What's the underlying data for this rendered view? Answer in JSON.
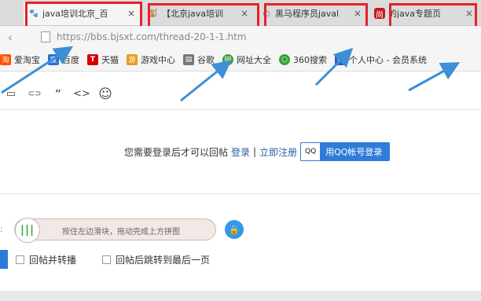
{
  "browser": {
    "tabs": [
      {
        "title": "java培训北京_百",
        "favicon": "paw-icon",
        "favicon_char": "🐾",
        "favicon_color": "#2b6fd6"
      },
      {
        "title": "【北京java培训",
        "favicon": "monkey-icon",
        "favicon_char": "🐒",
        "favicon_color": "#e08a1e"
      },
      {
        "title": "黑马程序员javal",
        "favicon": "globe-icon",
        "favicon_char": "◐",
        "favicon_color": "#666666"
      },
      {
        "title": "的java专题页",
        "favicon": "shang-icon",
        "favicon_char": "尚",
        "favicon_color": "#c41a1a"
      }
    ],
    "close_char": "×",
    "back_char": "‹",
    "url": "https://bbs.bjsxt.com/thread-20-1-1.htm"
  },
  "bookmarks": [
    {
      "label": "爱淘宝",
      "icon": "taobao-icon",
      "icon_char": "淘",
      "color": "#ff5000"
    },
    {
      "label": "百度",
      "icon": "baidu-paw-icon",
      "icon_char": "度",
      "color": "#2b6fd6"
    },
    {
      "label": "天猫",
      "icon": "tmall-icon",
      "icon_char": "T",
      "color": "#d40000"
    },
    {
      "label": "游戏中心",
      "icon": "game-icon",
      "icon_char": "游",
      "color": "#e89b1c"
    },
    {
      "label": "谷歌",
      "icon": "page-icon",
      "icon_char": "▤",
      "color": "#777777"
    },
    {
      "label": "网址大全",
      "icon": "sites-icon",
      "icon_char": "网",
      "color": "#3c9a3c"
    },
    {
      "label": "360搜索",
      "icon": "search360-icon",
      "icon_char": "○",
      "color": "#37a237"
    },
    {
      "label": "个人中心 - 会员系统",
      "icon": "member-icon",
      "icon_char": "▣",
      "color": "#2b5fb8"
    }
  ],
  "editor_toolbar": [
    {
      "name": "image-icon",
      "char": "▭"
    },
    {
      "name": "link-icon",
      "char": "⊂⊃"
    },
    {
      "name": "quote-icon",
      "char": "“"
    },
    {
      "name": "code-icon",
      "char": "<>"
    },
    {
      "name": "emoji-icon",
      "char": "☺"
    }
  ],
  "login": {
    "prompt": "您需要登录后才可以回帖",
    "login_link": "登录",
    "separator": "|",
    "register_link": "立即注册",
    "qq_badge": "QQ",
    "qq_button": "用QQ帐号登录"
  },
  "captcha": {
    "knob_char": "|||",
    "hint": "按住左边滑块，拖动完成上方拼图",
    "lock_char": "🔒",
    "edge_char": ":"
  },
  "options": {
    "repost": "回帖并转播",
    "jump_last": "回帖后跳转到最后一页"
  },
  "colors": {
    "highlight": "#e8202a",
    "arrow": "#3d8fd6",
    "link": "#2a5caa",
    "qq_button": "#2e7cd8"
  }
}
